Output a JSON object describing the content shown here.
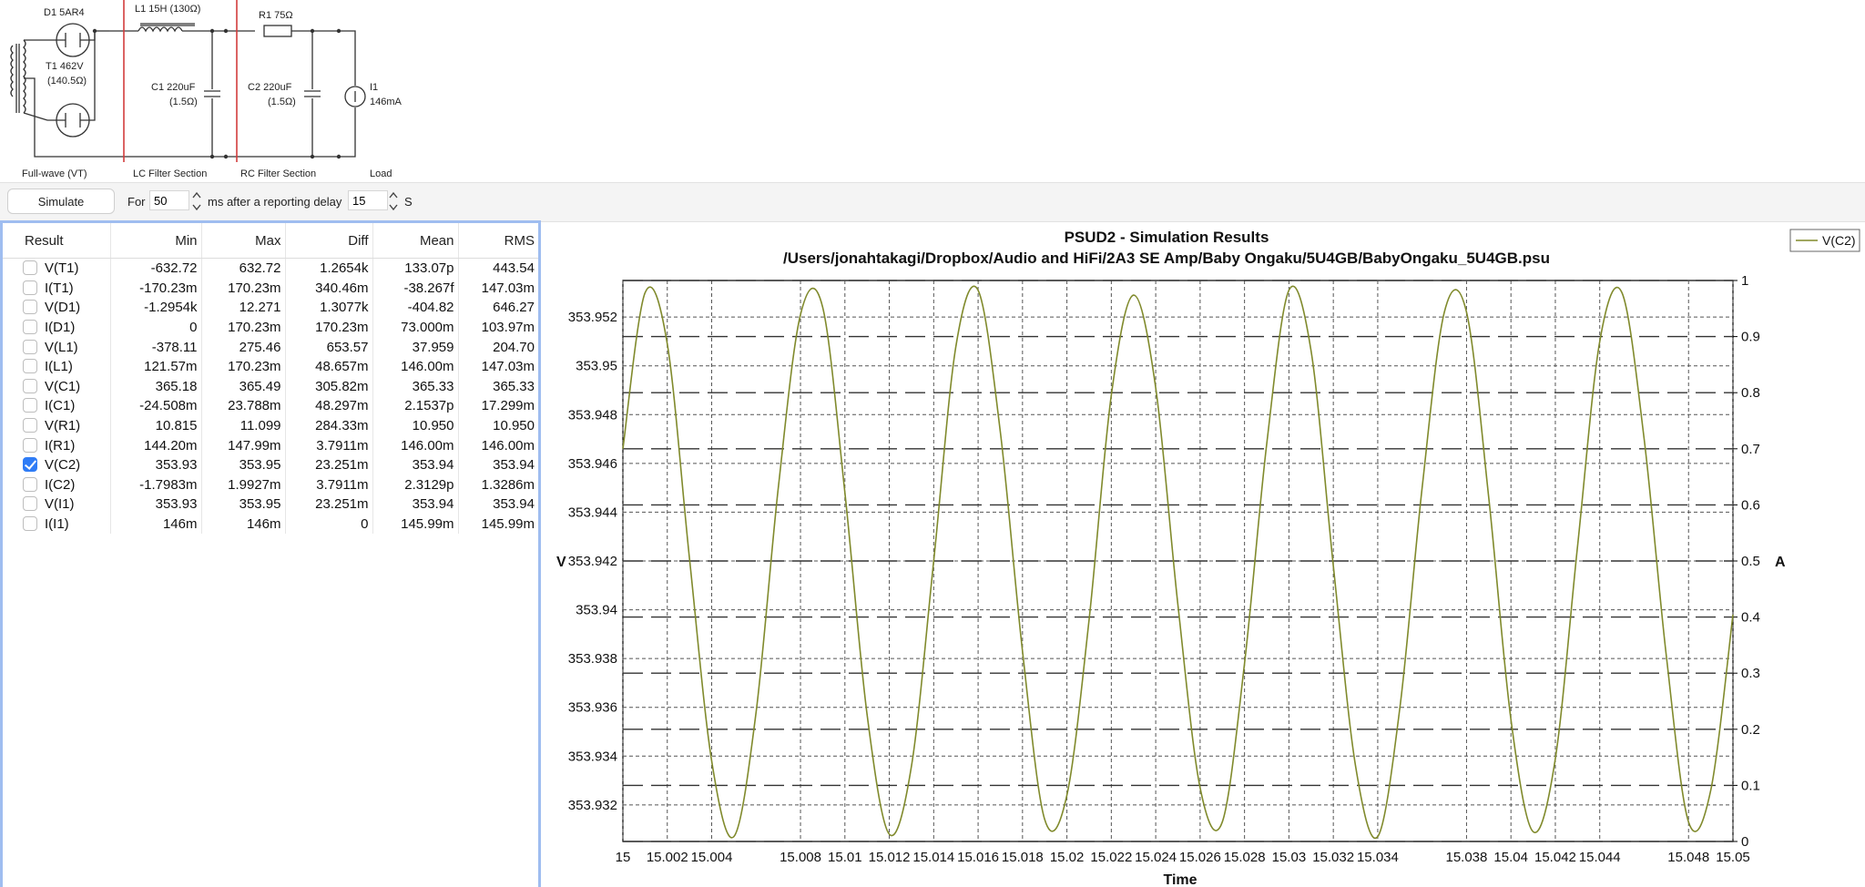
{
  "schematic": {
    "labels": {
      "d1": "D1 5AR4",
      "l1": "L1 15H (130Ω)",
      "r1": "R1 75Ω",
      "t1_line1": "T1 462V",
      "t1_line2": "(140.5Ω)",
      "c1_line1": "C1 220uF",
      "c1_line2": "(1.5Ω)",
      "c2_line1": "C2 220uF",
      "c2_line2": "(1.5Ω)",
      "i1_line1": "I1",
      "i1_line2": "146mA",
      "section_fullwave": "Full-wave (VT)",
      "section_lc": "LC Filter Section",
      "section_rc": "RC Filter Section",
      "section_load": "Load"
    }
  },
  "toolbar": {
    "simulate_label": "Simulate",
    "for_label": "For",
    "duration_value": "50",
    "after_label": "ms after a reporting delay",
    "delay_value": "15",
    "delay_unit": "S"
  },
  "results": {
    "columns": [
      "Result",
      "Min",
      "Max",
      "Diff",
      "Mean",
      "RMS"
    ],
    "rows": [
      {
        "name": "V(T1)",
        "checked": false,
        "min": "-632.72",
        "max": "632.72",
        "diff": "1.2654k",
        "mean": "133.07p",
        "rms": "443.54"
      },
      {
        "name": "I(T1)",
        "checked": false,
        "min": "-170.23m",
        "max": "170.23m",
        "diff": "340.46m",
        "mean": "-38.267f",
        "rms": "147.03m"
      },
      {
        "name": "V(D1)",
        "checked": false,
        "min": "-1.2954k",
        "max": "12.271",
        "diff": "1.3077k",
        "mean": "-404.82",
        "rms": "646.27"
      },
      {
        "name": "I(D1)",
        "checked": false,
        "min": "0",
        "max": "170.23m",
        "diff": "170.23m",
        "mean": "73.000m",
        "rms": "103.97m"
      },
      {
        "name": "V(L1)",
        "checked": false,
        "min": "-378.11",
        "max": "275.46",
        "diff": "653.57",
        "mean": "37.959",
        "rms": "204.70"
      },
      {
        "name": "I(L1)",
        "checked": false,
        "min": "121.57m",
        "max": "170.23m",
        "diff": "48.657m",
        "mean": "146.00m",
        "rms": "147.03m"
      },
      {
        "name": "V(C1)",
        "checked": false,
        "min": "365.18",
        "max": "365.49",
        "diff": "305.82m",
        "mean": "365.33",
        "rms": "365.33"
      },
      {
        "name": "I(C1)",
        "checked": false,
        "min": "-24.508m",
        "max": "23.788m",
        "diff": "48.297m",
        "mean": "2.1537p",
        "rms": "17.299m"
      },
      {
        "name": "V(R1)",
        "checked": false,
        "min": "10.815",
        "max": "11.099",
        "diff": "284.33m",
        "mean": "10.950",
        "rms": "10.950"
      },
      {
        "name": "I(R1)",
        "checked": false,
        "min": "144.20m",
        "max": "147.99m",
        "diff": "3.7911m",
        "mean": "146.00m",
        "rms": "146.00m"
      },
      {
        "name": "V(C2)",
        "checked": true,
        "min": "353.93",
        "max": "353.95",
        "diff": "23.251m",
        "mean": "353.94",
        "rms": "353.94"
      },
      {
        "name": "I(C2)",
        "checked": false,
        "min": "-1.7983m",
        "max": "1.9927m",
        "diff": "3.7911m",
        "mean": "2.3129p",
        "rms": "1.3286m"
      },
      {
        "name": "V(I1)",
        "checked": false,
        "min": "353.93",
        "max": "353.95",
        "diff": "23.251m",
        "mean": "353.94",
        "rms": "353.94"
      },
      {
        "name": "I(I1)",
        "checked": false,
        "min": "146m",
        "max": "146m",
        "diff": "0",
        "mean": "145.99m",
        "rms": "145.99m"
      }
    ]
  },
  "chart_data": {
    "type": "line",
    "title": "PSUD2 - Simulation Results",
    "subtitle": "/Users/jonahtakagi/Dropbox/Audio and HiFi/2A3 SE Amp/Baby Ongaku/5U4GB/BabyOngaku_5U4GB.psu",
    "xlabel": "Time",
    "ylabel": "V",
    "y2label": "A",
    "xlim": [
      15,
      15.05
    ],
    "ylim": [
      353.9305,
      353.9535
    ],
    "y2lim": [
      0,
      1
    ],
    "x_ticks": [
      "15",
      "15.002",
      "15.004",
      "15.008",
      "15.01",
      "15.012",
      "15.014",
      "15.016",
      "15.018",
      "15.02",
      "15.022",
      "15.024",
      "15.026",
      "15.028",
      "15.03",
      "15.032",
      "15.034",
      "15.038",
      "15.04",
      "15.042",
      "15.044",
      "15.048",
      "15.05"
    ],
    "y_ticks": [
      "353.932",
      "353.934",
      "353.936",
      "353.938",
      "353.94",
      "353.942",
      "353.944",
      "353.946",
      "353.948",
      "353.95",
      "353.952"
    ],
    "y2_ticks": [
      "0",
      "0.1",
      "0.2",
      "0.3",
      "0.4",
      "0.5",
      "0.6",
      "0.7",
      "0.8",
      "0.9",
      "1"
    ],
    "grid": true,
    "legend_position": "top-right",
    "series": [
      {
        "name": "V(C2)",
        "color": "#808a2c",
        "x": [
          15.0,
          15.001,
          15.002,
          15.003,
          15.004,
          15.005,
          15.006,
          15.007,
          15.008,
          15.009,
          15.01,
          15.011,
          15.012,
          15.013,
          15.014,
          15.015,
          15.016,
          15.017,
          15.018,
          15.019,
          15.02,
          15.021,
          15.022,
          15.023,
          15.024,
          15.025,
          15.026,
          15.027,
          15.028,
          15.029,
          15.03,
          15.031,
          15.032,
          15.033,
          15.034,
          15.035,
          15.036,
          15.037,
          15.038,
          15.039,
          15.04,
          15.041,
          15.042,
          15.043,
          15.044,
          15.045,
          15.046,
          15.047,
          15.048,
          15.049,
          15.05
        ],
        "values": [
          353.9466,
          353.953,
          353.9509,
          353.9421,
          353.9338,
          353.9307,
          353.9358,
          353.945,
          353.9521,
          353.9524,
          353.9448,
          353.9357,
          353.9308,
          353.9336,
          353.942,
          353.9508,
          353.9531,
          353.9473,
          353.9383,
          353.9314,
          353.9324,
          353.9396,
          353.9488,
          353.9529,
          353.9491,
          353.9402,
          353.9327,
          353.9313,
          353.9378,
          353.9468,
          353.9531,
          353.9506,
          353.9418,
          353.9336,
          353.9307,
          353.936,
          353.945,
          353.9522,
          353.9522,
          353.9446,
          353.9355,
          353.9309,
          353.9339,
          353.9426,
          353.951,
          353.953,
          353.947,
          353.9381,
          353.9313,
          353.9326,
          353.9398
        ]
      }
    ]
  }
}
